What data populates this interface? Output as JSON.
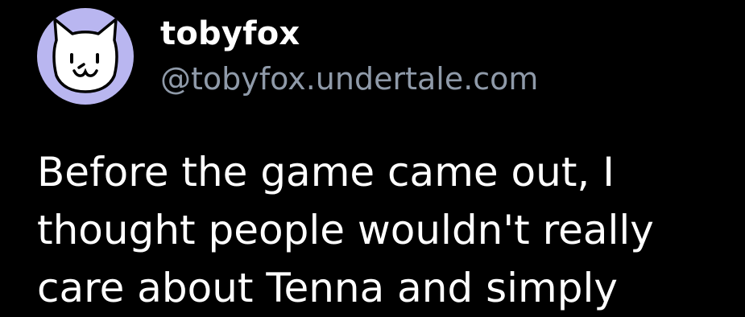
{
  "author": {
    "display_name": "tobyfox",
    "handle": "@tobyfox.undertale.com",
    "avatar_icon": "white-dog-face-icon",
    "avatar_bg_color": "#b9b6f0"
  },
  "post": {
    "text": "Before the game came out, I\nthought people wouldn't really\ncare about Tenna and simply"
  },
  "colors": {
    "background": "#000000",
    "text": "#ffffff",
    "handle": "#8f9aa9"
  }
}
